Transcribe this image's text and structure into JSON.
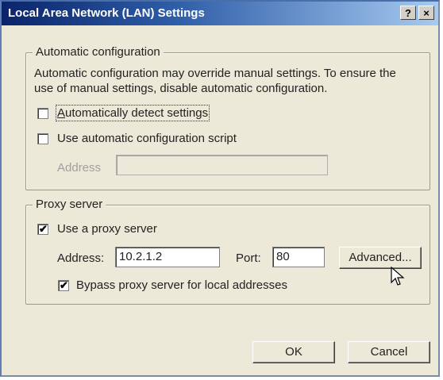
{
  "window": {
    "title": "Local Area Network (LAN) Settings",
    "help_button": "?",
    "close_button": "×"
  },
  "auto_config": {
    "legend": "Automatic configuration",
    "description_line1": "Automatic configuration may override manual settings.  To ensure the",
    "description_line2": "use of manual settings, disable automatic configuration.",
    "auto_detect": {
      "label": "Automatically detect settings",
      "checked": false
    },
    "use_script": {
      "label": "Use automatic configuration script",
      "checked": false
    },
    "address_label": "Address",
    "address_value": ""
  },
  "proxy": {
    "legend": "Proxy server",
    "use_proxy": {
      "label": "Use a proxy server",
      "checked": true
    },
    "address_label": "Address:",
    "address_value": "10.2.1.2",
    "port_label": "Port:",
    "port_value": "80",
    "advanced_label": "Advanced...",
    "bypass": {
      "label": "Bypass proxy server for local addresses",
      "checked": true
    }
  },
  "buttons": {
    "ok": "OK",
    "cancel": "Cancel"
  },
  "icons": {
    "check": "✔",
    "cursor": "mouse-pointer"
  }
}
